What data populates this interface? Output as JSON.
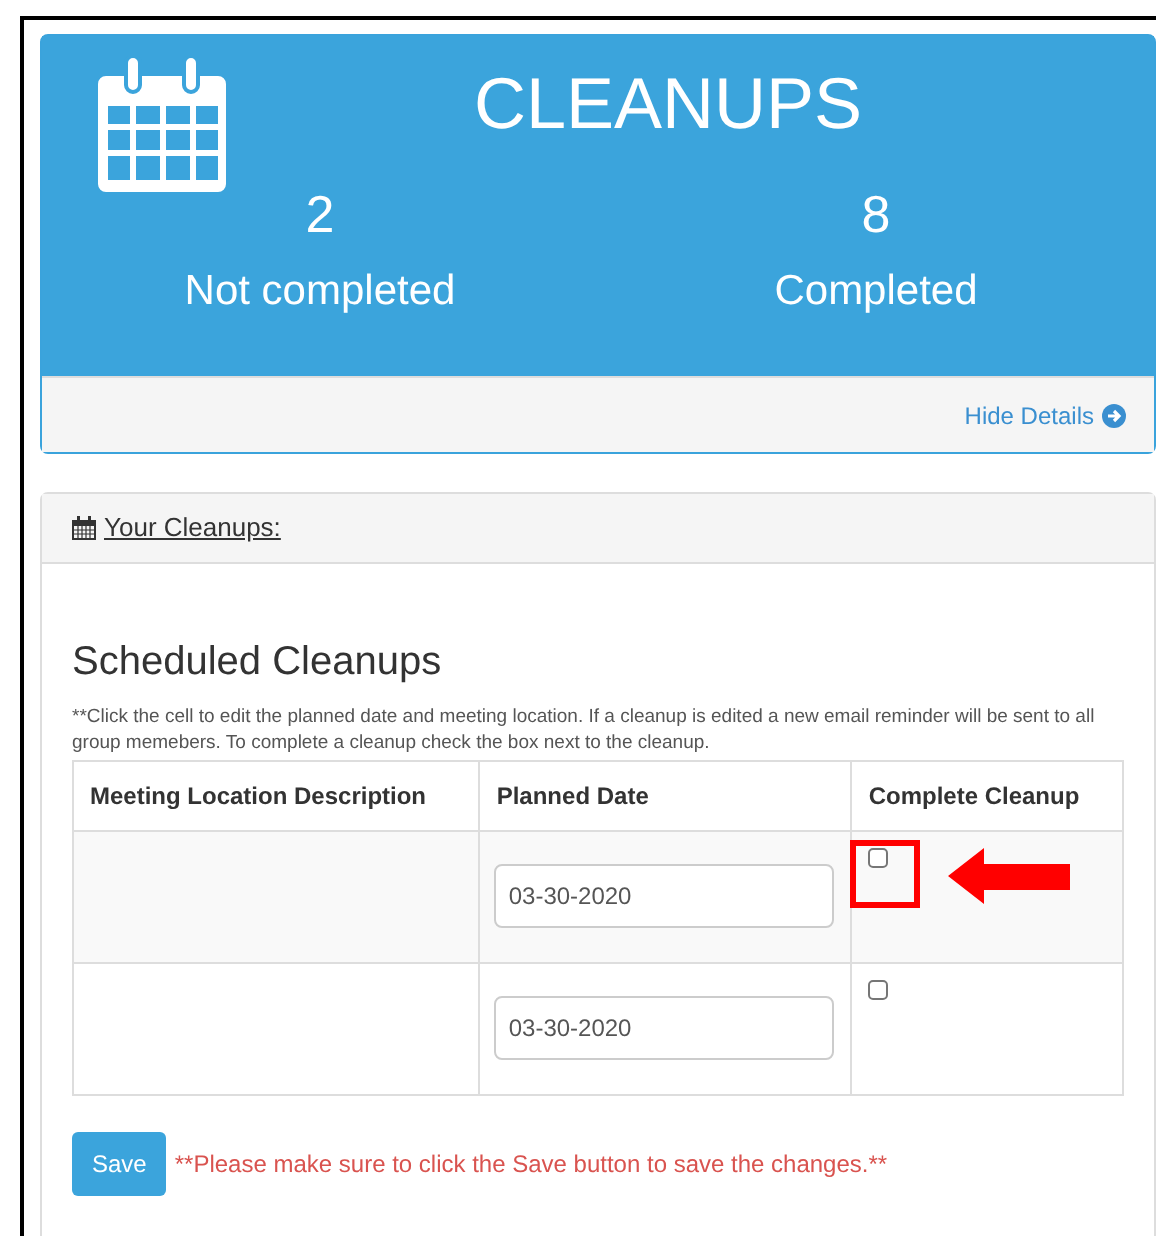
{
  "summary_card": {
    "title": "CLEANUPS",
    "stats": [
      {
        "value": "2",
        "label": "Not completed"
      },
      {
        "value": "8",
        "label": "Completed"
      }
    ],
    "footer_link": "Hide Details"
  },
  "panel": {
    "heading": "Your Cleanups:",
    "title": "Scheduled Cleanups",
    "note": "**Click the cell to edit the planned date and meeting location. If a cleanup is edited a new email reminder will be sent to all group memebers. To complete a cleanup check the box next to the cleanup.",
    "table": {
      "columns": [
        "Meeting Location Description",
        "Planned Date",
        "Complete Cleanup"
      ],
      "rows": [
        {
          "planned_date": "03-30-2020",
          "checked": false,
          "annotated": true
        },
        {
          "planned_date": "03-30-2020",
          "checked": false,
          "annotated": false
        }
      ]
    },
    "save_button": "Save",
    "save_warning": "**Please make sure to click the Save button to save the changes.**"
  }
}
